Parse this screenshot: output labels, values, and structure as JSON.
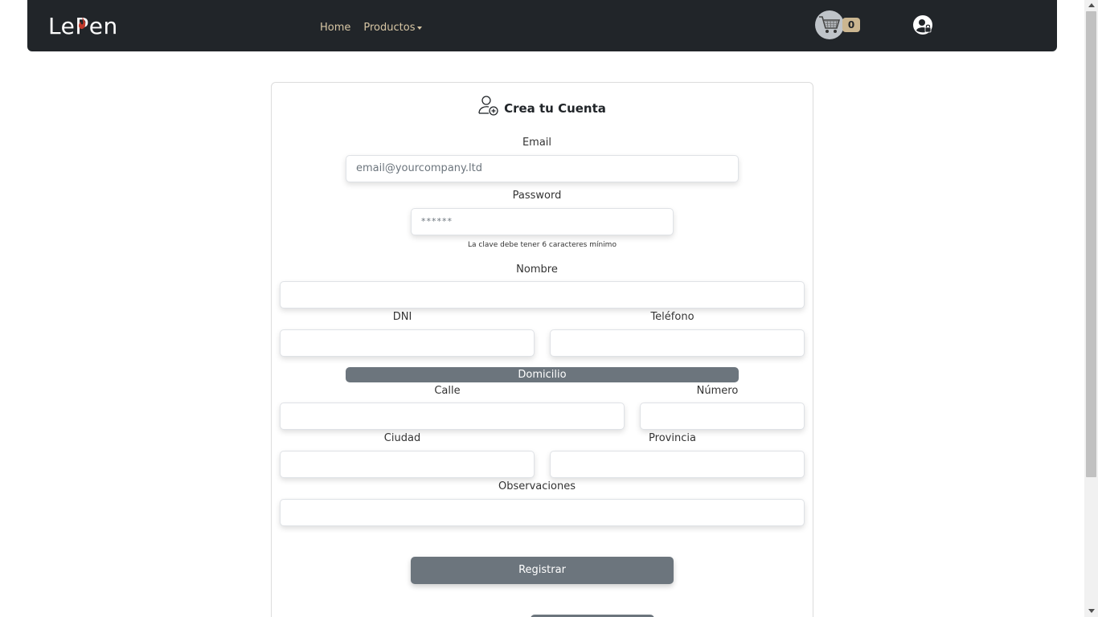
{
  "navbar": {
    "brand": "LePen",
    "links": [
      {
        "label": "Home"
      },
      {
        "label": "Productos"
      }
    ],
    "cart_count": "0"
  },
  "form": {
    "title": "Crea tu Cuenta",
    "email": {
      "label": "Email",
      "placeholder": "email@yourcompany.ltd"
    },
    "password": {
      "label": "Password",
      "placeholder": "******",
      "hint": "La clave debe tener 6 caracteres mínimo"
    },
    "nombre": {
      "label": "Nombre",
      "value": ""
    },
    "dni": {
      "label": "DNI",
      "value": ""
    },
    "telefono": {
      "label": "Teléfono",
      "value": ""
    },
    "domicilio_section": "Domicilio",
    "calle": {
      "label": "Calle",
      "value": ""
    },
    "numero": {
      "label": "Número",
      "value": ""
    },
    "ciudad": {
      "label": "Ciudad",
      "value": ""
    },
    "provincia": {
      "label": "Provincia",
      "value": ""
    },
    "observaciones": {
      "label": "Observaciones",
      "value": ""
    },
    "submit_label": "Registrar"
  },
  "colors": {
    "navbar_bg": "#212529",
    "nav_link": "#d7c6a4",
    "button_bg": "#6c757d",
    "badge_bg": "#cbb690"
  }
}
